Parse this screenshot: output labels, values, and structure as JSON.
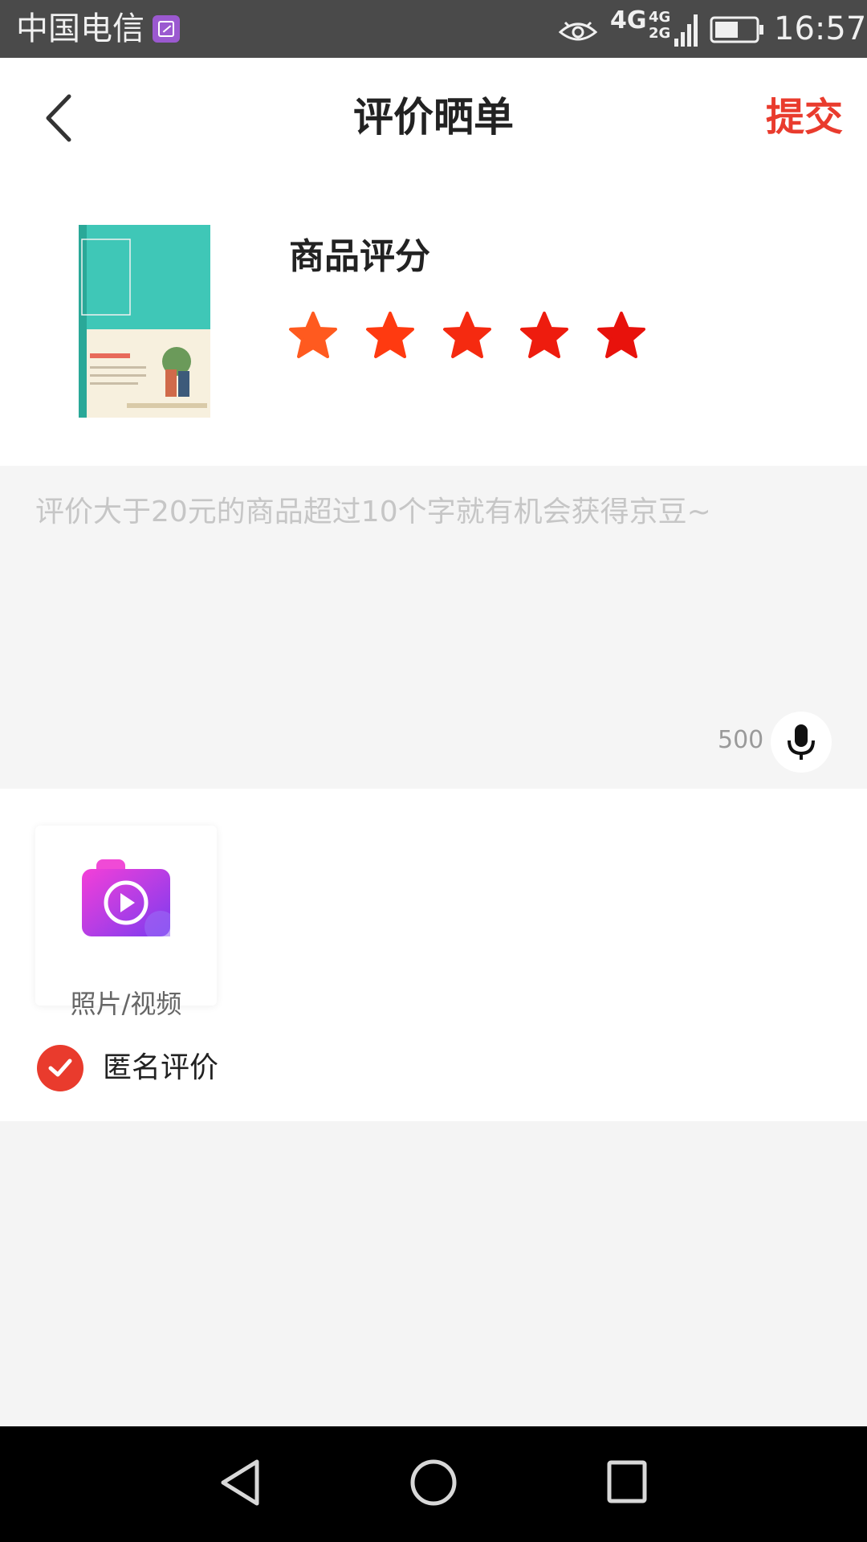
{
  "status_bar": {
    "carrier": "中国电信",
    "network_primary": "4G",
    "network_secondary_top": "4G",
    "network_secondary_bottom": "2G",
    "time": "16:57",
    "icons": [
      "gallery-icon",
      "eye-icon",
      "signal-icon",
      "battery-icon"
    ]
  },
  "header": {
    "title": "评价晒单",
    "submit_label": "提交",
    "back_icon": "chevron-left-icon"
  },
  "product": {
    "rating_title": "商品评分",
    "rating_value": 5,
    "rating_max": 5
  },
  "review": {
    "placeholder": "评价大于20元的商品超过10个字就有机会获得京豆~",
    "char_count": "500",
    "mic_icon": "microphone-icon"
  },
  "media": {
    "label": "照片/视频",
    "icon": "camera-video-icon"
  },
  "anonymous": {
    "label": "匿名评价",
    "checked": true
  },
  "colors": {
    "accent": "#e93b2d",
    "star_gradient": [
      "#ff5a1f",
      "#ff3a10",
      "#f52a10",
      "#ee1c0e",
      "#e8120c"
    ]
  },
  "nav_bar": {
    "icons": [
      "nav-back-icon",
      "nav-home-icon",
      "nav-recent-icon"
    ]
  }
}
